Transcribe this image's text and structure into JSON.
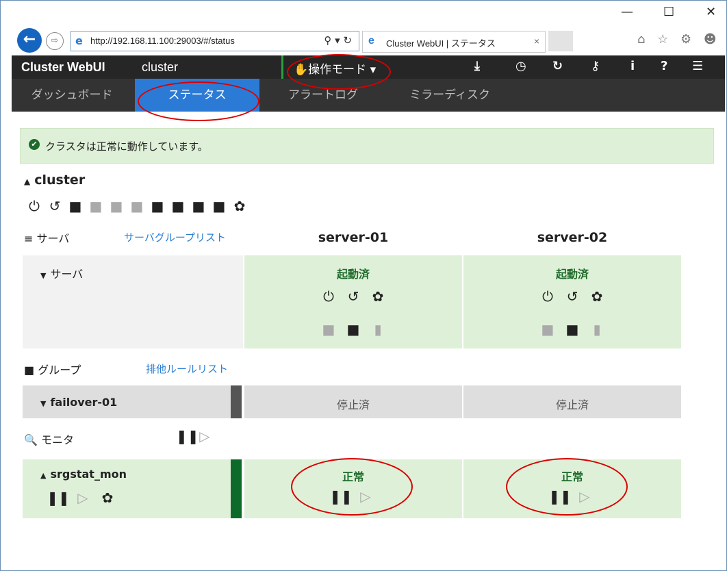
{
  "window": {
    "minimize": "—",
    "maximize": "☐",
    "close": "✕"
  },
  "browser": {
    "back_icon": "←",
    "forward_icon": "⇨",
    "url": "http://192.168.11.100:29003/#/status",
    "addr_tools": "⚲ ▾ ↻",
    "tab_title": "Cluster WebUI | ステータス",
    "tab_close": "×",
    "toolbar_icons": "⌂ ☆ ⚙ ☻"
  },
  "header": {
    "brand": "Cluster WebUI",
    "cluster_name": "cluster",
    "mode_label": "✋操作モード ▾",
    "icons": [
      "⤓",
      "◷",
      "↻",
      "⚷",
      "i",
      "?",
      "☰"
    ]
  },
  "nav": {
    "tabs": [
      {
        "label": "ダッシュボード"
      },
      {
        "label": "ステータス"
      },
      {
        "label": "アラートログ"
      },
      {
        "label": "ミラーディスク"
      }
    ]
  },
  "alert": {
    "icon": "✔",
    "text": "クラスタは正常に動作しています。"
  },
  "cluster": {
    "title": "cluster",
    "toggle": "▲",
    "icons": [
      "⏻",
      "↺",
      "■",
      "■",
      "■",
      "■",
      "■",
      "■",
      "■",
      "■",
      "✿"
    ]
  },
  "servers": {
    "section_label": "サーバ",
    "section_icon": "≡",
    "link": "サーバグループリスト",
    "columns": [
      "server-01",
      "server-02"
    ],
    "row_label": "サーバ",
    "row_toggle": "▼",
    "status": [
      "起動済",
      "起動済"
    ],
    "action_icons": [
      "⏻",
      "↺",
      "✿"
    ],
    "sub_icons": [
      "■",
      "■",
      "▮"
    ]
  },
  "groups": {
    "section_label": "グループ",
    "section_icon": "■",
    "link": "排他ルールリスト",
    "row_label": "failover-01",
    "row_toggle": "▼",
    "status": [
      "停止済",
      "停止済"
    ]
  },
  "monitors": {
    "section_label": "モニタ",
    "section_icon": "🔍",
    "header_icons": [
      "❚❚",
      "▷"
    ],
    "row_label": "srgstat_mon",
    "row_toggle": "▲",
    "row_icons": [
      "❚❚",
      "▷",
      "✿"
    ],
    "status": [
      "正常",
      "正常"
    ],
    "cell_icons": [
      "❚❚",
      "▷"
    ]
  }
}
